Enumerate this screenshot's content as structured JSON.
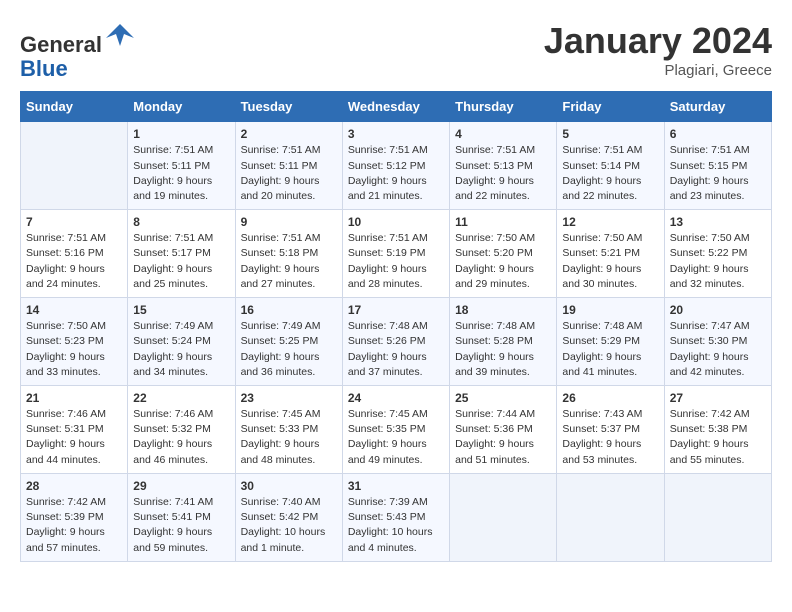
{
  "header": {
    "logo_line1": "General",
    "logo_line2": "Blue",
    "month_title": "January 2024",
    "location": "Plagiari, Greece"
  },
  "days_of_week": [
    "Sunday",
    "Monday",
    "Tuesday",
    "Wednesday",
    "Thursday",
    "Friday",
    "Saturday"
  ],
  "weeks": [
    [
      {
        "day": "",
        "empty": true
      },
      {
        "day": "1",
        "sunrise": "7:51 AM",
        "sunset": "5:11 PM",
        "daylight": "9 hours and 19 minutes."
      },
      {
        "day": "2",
        "sunrise": "7:51 AM",
        "sunset": "5:11 PM",
        "daylight": "9 hours and 20 minutes."
      },
      {
        "day": "3",
        "sunrise": "7:51 AM",
        "sunset": "5:12 PM",
        "daylight": "9 hours and 21 minutes."
      },
      {
        "day": "4",
        "sunrise": "7:51 AM",
        "sunset": "5:13 PM",
        "daylight": "9 hours and 22 minutes."
      },
      {
        "day": "5",
        "sunrise": "7:51 AM",
        "sunset": "5:14 PM",
        "daylight": "9 hours and 22 minutes."
      },
      {
        "day": "6",
        "sunrise": "7:51 AM",
        "sunset": "5:15 PM",
        "daylight": "9 hours and 23 minutes."
      }
    ],
    [
      {
        "day": "7",
        "sunrise": "7:51 AM",
        "sunset": "5:16 PM",
        "daylight": "9 hours and 24 minutes."
      },
      {
        "day": "8",
        "sunrise": "7:51 AM",
        "sunset": "5:17 PM",
        "daylight": "9 hours and 25 minutes."
      },
      {
        "day": "9",
        "sunrise": "7:51 AM",
        "sunset": "5:18 PM",
        "daylight": "9 hours and 27 minutes."
      },
      {
        "day": "10",
        "sunrise": "7:51 AM",
        "sunset": "5:19 PM",
        "daylight": "9 hours and 28 minutes."
      },
      {
        "day": "11",
        "sunrise": "7:50 AM",
        "sunset": "5:20 PM",
        "daylight": "9 hours and 29 minutes."
      },
      {
        "day": "12",
        "sunrise": "7:50 AM",
        "sunset": "5:21 PM",
        "daylight": "9 hours and 30 minutes."
      },
      {
        "day": "13",
        "sunrise": "7:50 AM",
        "sunset": "5:22 PM",
        "daylight": "9 hours and 32 minutes."
      }
    ],
    [
      {
        "day": "14",
        "sunrise": "7:50 AM",
        "sunset": "5:23 PM",
        "daylight": "9 hours and 33 minutes."
      },
      {
        "day": "15",
        "sunrise": "7:49 AM",
        "sunset": "5:24 PM",
        "daylight": "9 hours and 34 minutes."
      },
      {
        "day": "16",
        "sunrise": "7:49 AM",
        "sunset": "5:25 PM",
        "daylight": "9 hours and 36 minutes."
      },
      {
        "day": "17",
        "sunrise": "7:48 AM",
        "sunset": "5:26 PM",
        "daylight": "9 hours and 37 minutes."
      },
      {
        "day": "18",
        "sunrise": "7:48 AM",
        "sunset": "5:28 PM",
        "daylight": "9 hours and 39 minutes."
      },
      {
        "day": "19",
        "sunrise": "7:48 AM",
        "sunset": "5:29 PM",
        "daylight": "9 hours and 41 minutes."
      },
      {
        "day": "20",
        "sunrise": "7:47 AM",
        "sunset": "5:30 PM",
        "daylight": "9 hours and 42 minutes."
      }
    ],
    [
      {
        "day": "21",
        "sunrise": "7:46 AM",
        "sunset": "5:31 PM",
        "daylight": "9 hours and 44 minutes."
      },
      {
        "day": "22",
        "sunrise": "7:46 AM",
        "sunset": "5:32 PM",
        "daylight": "9 hours and 46 minutes."
      },
      {
        "day": "23",
        "sunrise": "7:45 AM",
        "sunset": "5:33 PM",
        "daylight": "9 hours and 48 minutes."
      },
      {
        "day": "24",
        "sunrise": "7:45 AM",
        "sunset": "5:35 PM",
        "daylight": "9 hours and 49 minutes."
      },
      {
        "day": "25",
        "sunrise": "7:44 AM",
        "sunset": "5:36 PM",
        "daylight": "9 hours and 51 minutes."
      },
      {
        "day": "26",
        "sunrise": "7:43 AM",
        "sunset": "5:37 PM",
        "daylight": "9 hours and 53 minutes."
      },
      {
        "day": "27",
        "sunrise": "7:42 AM",
        "sunset": "5:38 PM",
        "daylight": "9 hours and 55 minutes."
      }
    ],
    [
      {
        "day": "28",
        "sunrise": "7:42 AM",
        "sunset": "5:39 PM",
        "daylight": "9 hours and 57 minutes."
      },
      {
        "day": "29",
        "sunrise": "7:41 AM",
        "sunset": "5:41 PM",
        "daylight": "9 hours and 59 minutes."
      },
      {
        "day": "30",
        "sunrise": "7:40 AM",
        "sunset": "5:42 PM",
        "daylight": "10 hours and 1 minute."
      },
      {
        "day": "31",
        "sunrise": "7:39 AM",
        "sunset": "5:43 PM",
        "daylight": "10 hours and 4 minutes."
      },
      {
        "day": "",
        "empty": true
      },
      {
        "day": "",
        "empty": true
      },
      {
        "day": "",
        "empty": true
      }
    ]
  ]
}
